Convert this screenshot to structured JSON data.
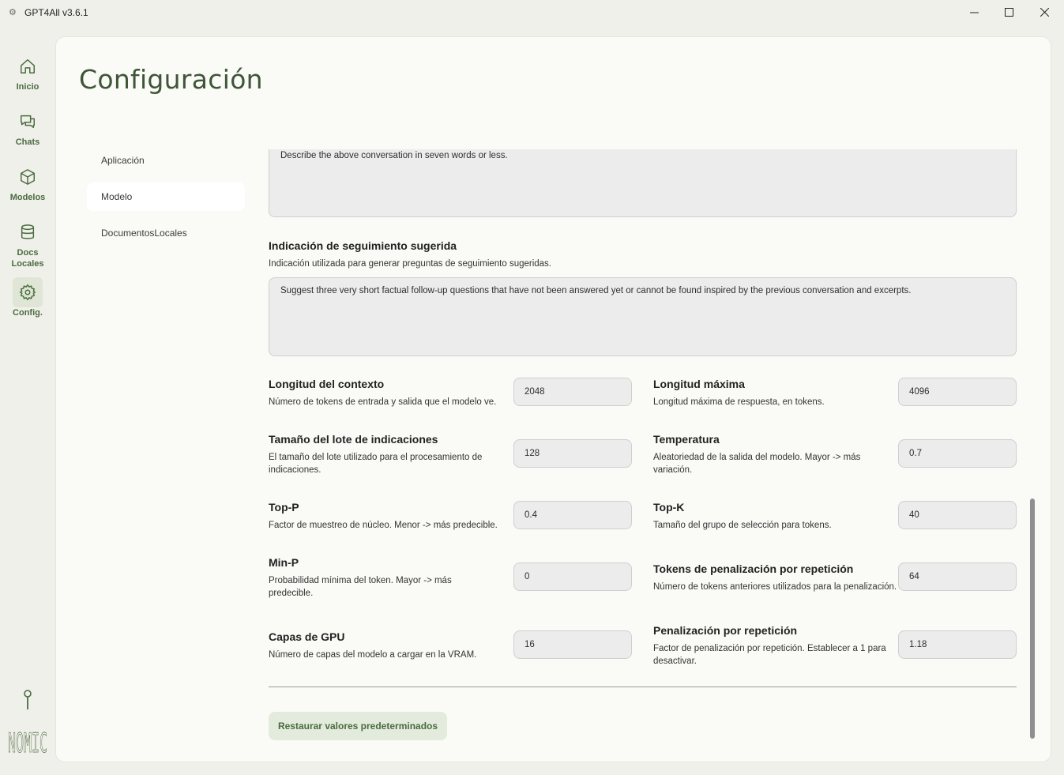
{
  "window": {
    "title": "GPT4All v3.6.1"
  },
  "nav": {
    "items": [
      {
        "label": "Inicio",
        "icon": "home-icon"
      },
      {
        "label": "Chats",
        "icon": "chat-icon"
      },
      {
        "label": "Modelos",
        "icon": "cube-icon"
      },
      {
        "label": "Docs\nLocales",
        "icon": "database-icon"
      },
      {
        "label": "Config.",
        "icon": "gear-icon",
        "active": true
      }
    ],
    "logo_text": "NOMIC"
  },
  "page": {
    "title": "Configuración"
  },
  "subnav": {
    "items": [
      {
        "label": "Aplicación"
      },
      {
        "label": "Modelo",
        "active": true
      },
      {
        "label": "DocumentosLocales"
      }
    ]
  },
  "settings": {
    "chat_name_prompt_value": "Describe the above conversation in seven words or less.",
    "followup": {
      "title": "Indicación de seguimiento sugerida",
      "desc": "Indicación utilizada para generar preguntas de seguimiento sugeridas.",
      "value": "Suggest three very short factual follow-up questions that have not been answered yet or cannot be found inspired by the previous conversation and excerpts."
    },
    "fields": {
      "context_length": {
        "label": "Longitud del contexto",
        "desc": "Número de tokens de entrada y salida que el modelo ve.",
        "value": "2048"
      },
      "max_length": {
        "label": "Longitud máxima",
        "desc": "Longitud máxima de respuesta, en tokens.",
        "value": "4096"
      },
      "batch_size": {
        "label": "Tamaño del lote de indicaciones",
        "desc": "El tamaño del lote utilizado para el procesamiento de indicaciones.",
        "value": "128"
      },
      "temperature": {
        "label": "Temperatura",
        "desc": "Aleatoriedad de la salida del modelo. Mayor -> más variación.",
        "value": "0.7"
      },
      "top_p": {
        "label": "Top-P",
        "desc": "Factor de muestreo de núcleo. Menor -> más predecible.",
        "value": "0.4"
      },
      "top_k": {
        "label": "Top-K",
        "desc": "Tamaño del grupo de selección para tokens.",
        "value": "40"
      },
      "min_p": {
        "label": "Min-P",
        "desc": "Probabilidad mínima del token. Mayor -> más predecible.",
        "value": "0"
      },
      "repeat_tokens": {
        "label": "Tokens de penalización por repetición",
        "desc": "Número de tokens anteriores utilizados para la penalización.",
        "value": "64"
      },
      "gpu_layers": {
        "label": "Capas de GPU",
        "desc": "Número de capas del modelo a cargar en la VRAM.",
        "value": "16"
      },
      "repeat_penalty": {
        "label": "Penalización por repetición",
        "desc": "Factor de penalización por repetición. Establecer a 1 para desactivar.",
        "value": "1.18"
      }
    },
    "restore_label": "Restaurar valores predeterminados"
  },
  "colors": {
    "accent": "#4a6b40",
    "title": "#3f5538",
    "active_bg": "#dfe6d6",
    "restore_bg": "#e3ebdc"
  }
}
